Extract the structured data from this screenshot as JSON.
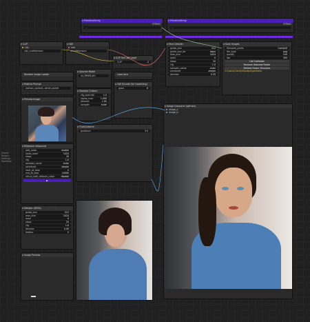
{
  "colors": {
    "accent": "#6e2de0",
    "orange": "#c8871a",
    "canvas": "#202020",
    "node": "#2a2a2a"
  },
  "primitive1": {
    "title": "PrimitiveString",
    "output": "STRING",
    "value": "..."
  },
  "primitive2": {
    "title": "PrimitiveString",
    "output": "STRING",
    "value": "..."
  },
  "clip1": {
    "title": "CLIP",
    "row": "clip",
    "value": "clip_l.safetensors"
  },
  "vae1": {
    "title": "VAE",
    "row": "vae",
    "value": "ae.safetensors"
  },
  "clipl": {
    "title": "CLIP Set Last Layer",
    "label": "CLIP",
    "val": "-2"
  },
  "sampler_btn": {
    "title": "Random Image Loader"
  },
  "loraloader": {
    "title": "Load Lora"
  },
  "prompt_node": {
    "title": "Positive Prompt",
    "value": "woman, portrait, denim jacket"
  },
  "preview1": {
    "title": "Preview Image"
  },
  "ksampler": {
    "title": "KSampler Advanced",
    "rows": [
      {
        "k": "add_noise",
        "v": "enable"
      },
      {
        "k": "noise_seed",
        "v": "1024"
      },
      {
        "k": "steps",
        "v": "20"
      },
      {
        "k": "cfg",
        "v": "1.0"
      },
      {
        "k": "sampler_name",
        "v": "euler"
      },
      {
        "k": "scheduler",
        "v": "simple"
      },
      {
        "k": "start_at_step",
        "v": "0"
      },
      {
        "k": "end_at_step",
        "v": "10000"
      },
      {
        "k": "return_with_leftover_noise",
        "v": "disable"
      }
    ]
  },
  "upscale": {
    "title": "Upscale Model",
    "value": "4x_NMKD.pth"
  },
  "vae_encode": {
    "title": "VAE Encode (for Inpainting)",
    "grow": "6"
  },
  "flux_guid": {
    "title": "FluxGuidance",
    "guidance": "3.5"
  },
  "sampler2": {
    "title": "Sampler Custom",
    "rows": [
      {
        "k": "cfg_override",
        "v": "1.0"
      },
      {
        "k": "sigma_max",
        "v": "1.000"
      },
      {
        "k": "denoise",
        "v": "1.00"
      },
      {
        "k": "sampler",
        "v": "euler"
      }
    ]
  },
  "image_compare": {
    "title": "Image Comparer (rgthree)",
    "a": "image_a",
    "b": "image_b"
  },
  "face_detail": {
    "title": "Face Detailer",
    "rows": [
      {
        "k": "guide_size",
        "v": "512"
      },
      {
        "k": "guide_size_for",
        "v": "bbox"
      },
      {
        "k": "max_size",
        "v": "1024"
      },
      {
        "k": "seed",
        "v": "0"
      },
      {
        "k": "steps",
        "v": "20"
      },
      {
        "k": "cfg",
        "v": "1.0"
      },
      {
        "k": "sampler_name",
        "v": "euler"
      },
      {
        "k": "scheduler",
        "v": "simple"
      },
      {
        "k": "denoise",
        "v": "0.35"
      }
    ]
  },
  "save_images": {
    "title": "Save Images",
    "rows": [
      {
        "k": "filename_prefix",
        "v": "ComfyUI"
      },
      {
        "k": "file_type",
        "v": "png"
      },
      {
        "k": "quality",
        "v": "100"
      },
      {
        "k": "dpi",
        "v": "300"
      }
    ],
    "btn1": "List Subfolder",
    "btn2": "Remove Selected Folder",
    "btn3": "Refresh Folder Structure",
    "path": "C:\\Users\\ComfyUI\\output\\portraits"
  },
  "detailer2": {
    "title": "Detailer (SEGS)",
    "rows": [
      {
        "k": "guide_size",
        "v": "512"
      },
      {
        "k": "max_size",
        "v": "1024"
      },
      {
        "k": "seed",
        "v": "0"
      },
      {
        "k": "steps",
        "v": "20"
      },
      {
        "k": "cfg",
        "v": "1.0"
      },
      {
        "k": "denoise",
        "v": "0.40"
      },
      {
        "k": "feather",
        "v": "5"
      }
    ]
  },
  "prev_last": {
    "title": "Image Preview"
  },
  "sidebar_note": {
    "lines": [
      "Queue",
      "History",
      "Settings",
      "Workflow"
    ]
  }
}
